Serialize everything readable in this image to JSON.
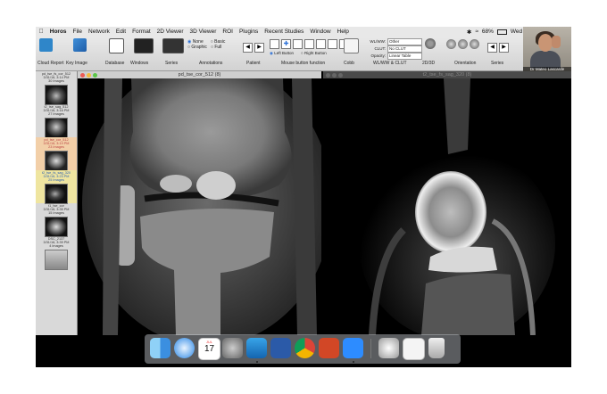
{
  "menubar": {
    "apple": "",
    "app_name": "Horos",
    "items": [
      "File",
      "Network",
      "Edit",
      "Format",
      "2D Viewer",
      "3D Viewer",
      "ROI",
      "Plugins",
      "Recent Studies",
      "Window",
      "Help"
    ],
    "battery": "68%",
    "clock": "Wed 7:4"
  },
  "toolbar": {
    "cloud_report": "Cloud Report",
    "key_image": "Key Image",
    "database": "Database",
    "windows": "Windows",
    "series": "Series",
    "annotations": "Annotations",
    "patient": "Patient",
    "mouse_button_function": "Mouse button function",
    "cobb": "Cobb",
    "wlww_clut": "WL/WW & CLUT",
    "threed": "2D/3D",
    "orientation": "Orientation",
    "series_nav": "Series",
    "annotation_options": [
      "None",
      "Basic",
      "Graphic",
      "Full"
    ],
    "left_button": "Left Button",
    "right_button": "Right Button",
    "wlww_label": "WL/WW:",
    "wlww_value": "Other",
    "clut_label": "CLUT:",
    "clut_value": "No CLUT",
    "opacity_label": "Opacity:",
    "opacity_value": "Linear Table"
  },
  "webcam": {
    "name": "Dr Mateo Lascarde"
  },
  "sidebar": {
    "series": [
      {
        "name": "pd_tse_fs_cor_512",
        "date": "3/31/16, 3:14 PM",
        "count": "30 Images"
      },
      {
        "name": "t2_tse_sag_512",
        "date": "3/31/16, 3:16 PM",
        "count": "27 Images"
      },
      {
        "name": "pd_tse_cor_512",
        "date": "3/31/16, 3:19 PM",
        "count": "23 Images"
      },
      {
        "name": "t2_tse_fs_sag_320",
        "date": "3/31/16, 3:23 PM",
        "count": "25 Images"
      },
      {
        "name": "t1_tse_cor",
        "date": "3/31/16, 3:35 PM",
        "count": "15 Images"
      },
      {
        "name": "DSC_2137",
        "date": "3/31/16, 3:39 PM",
        "count": "4 Images"
      }
    ]
  },
  "viewers": {
    "left_title": "pd_tse_cor_512 (8)",
    "right_title": "t2_tse_fs_sag_320 (8)"
  },
  "dock": {
    "calendar_month": "JUL",
    "calendar_day": "17"
  }
}
